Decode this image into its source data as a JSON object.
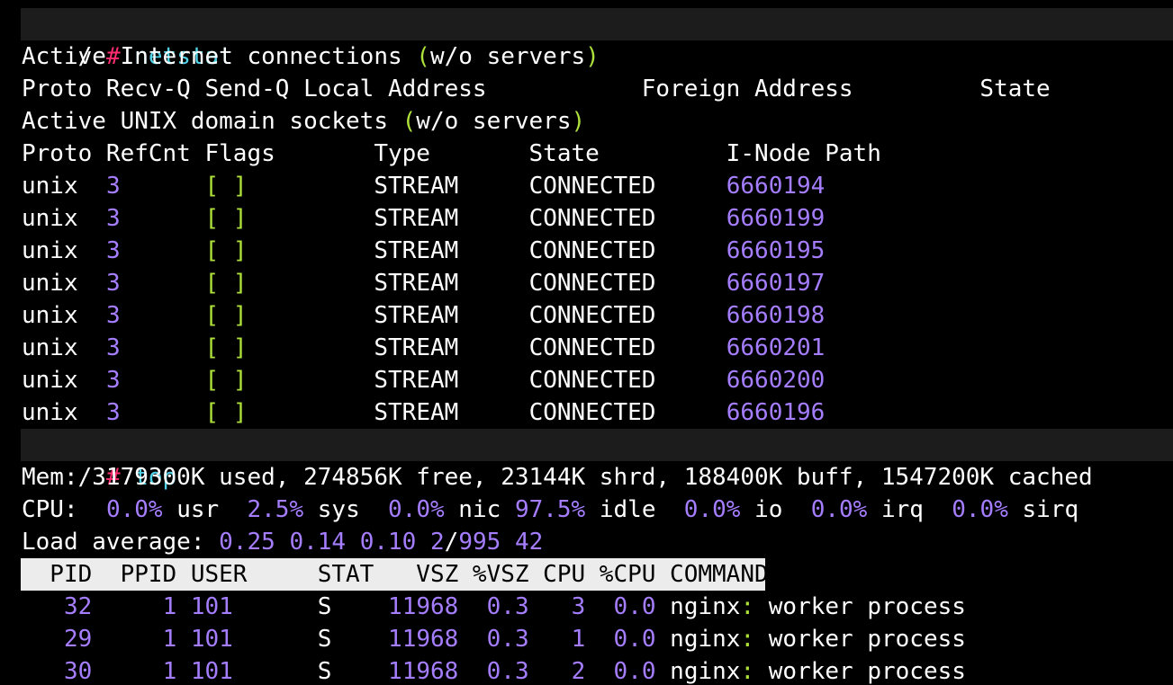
{
  "prompt1": {
    "prefix": "/ ",
    "hash": "#",
    "command": "netstat"
  },
  "inet": {
    "title_a": "Active Internet connections ",
    "paren_open": "(",
    "title_b": "w/o servers",
    "paren_close": ")",
    "header": "Proto Recv-Q Send-Q Local Address           Foreign Address         State"
  },
  "unix": {
    "title_a": "Active UNIX domain sockets ",
    "paren_open": "(",
    "title_b": "w/o servers",
    "paren_close": ")",
    "header": "Proto RefCnt Flags       Type       State         I-Node Path",
    "rows": [
      {
        "proto": "unix",
        "refcnt": "3",
        "flags": "[ ]",
        "type": "STREAM",
        "state": "CONNECTED",
        "inode": "6660194"
      },
      {
        "proto": "unix",
        "refcnt": "3",
        "flags": "[ ]",
        "type": "STREAM",
        "state": "CONNECTED",
        "inode": "6660199"
      },
      {
        "proto": "unix",
        "refcnt": "3",
        "flags": "[ ]",
        "type": "STREAM",
        "state": "CONNECTED",
        "inode": "6660195"
      },
      {
        "proto": "unix",
        "refcnt": "3",
        "flags": "[ ]",
        "type": "STREAM",
        "state": "CONNECTED",
        "inode": "6660197"
      },
      {
        "proto": "unix",
        "refcnt": "3",
        "flags": "[ ]",
        "type": "STREAM",
        "state": "CONNECTED",
        "inode": "6660198"
      },
      {
        "proto": "unix",
        "refcnt": "3",
        "flags": "[ ]",
        "type": "STREAM",
        "state": "CONNECTED",
        "inode": "6660201"
      },
      {
        "proto": "unix",
        "refcnt": "3",
        "flags": "[ ]",
        "type": "STREAM",
        "state": "CONNECTED",
        "inode": "6660200"
      },
      {
        "proto": "unix",
        "refcnt": "3",
        "flags": "[ ]",
        "type": "STREAM",
        "state": "CONNECTED",
        "inode": "6660196"
      }
    ]
  },
  "prompt2": {
    "prefix": "/ ",
    "hash": "#",
    "command": "top"
  },
  "top": {
    "mem": "Mem: 3179300K used, 274856K free, 23144K shrd, 188400K buff, 1547200K cached",
    "cpu": {
      "label": "CPU:",
      "usr": "0.0%",
      "sys": "2.5%",
      "nic": "0.0%",
      "idle": "97.5%",
      "io": "0.0%",
      "irq": "0.0%",
      "sirq": "0.0%"
    },
    "load": {
      "label": "Load average:",
      "v1": "0.25",
      "v2": "0.14",
      "v3": "0.10",
      "running": "2",
      "total": "995",
      "last_pid": "42"
    },
    "header": "  PID  PPID USER     STAT   VSZ %VSZ CPU %CPU COMMAND",
    "rows": [
      {
        "pid": "32",
        "ppid": "1",
        "user": "101",
        "stat": "S",
        "vsz": "11968",
        "pvsz": "0.3",
        "cpu": "3",
        "pcpu": "0.0",
        "cmd_name": "nginx",
        "cmd_rest": "worker process"
      },
      {
        "pid": "29",
        "ppid": "1",
        "user": "101",
        "stat": "S",
        "vsz": "11968",
        "pvsz": "0.3",
        "cpu": "1",
        "pcpu": "0.0",
        "cmd_name": "nginx",
        "cmd_rest": "worker process"
      },
      {
        "pid": "30",
        "ppid": "1",
        "user": "101",
        "stat": "S",
        "vsz": "11968",
        "pvsz": "0.3",
        "cpu": "2",
        "pcpu": "0.0",
        "cmd_name": "nginx",
        "cmd_rest": "worker process"
      }
    ]
  },
  "colors": {
    "background": "#000000",
    "prompt_hash": "#ff2d6f",
    "command": "#4fd1e6",
    "number": "#a57dff",
    "punct": "#aee13a",
    "header_bg": "#ececec"
  }
}
